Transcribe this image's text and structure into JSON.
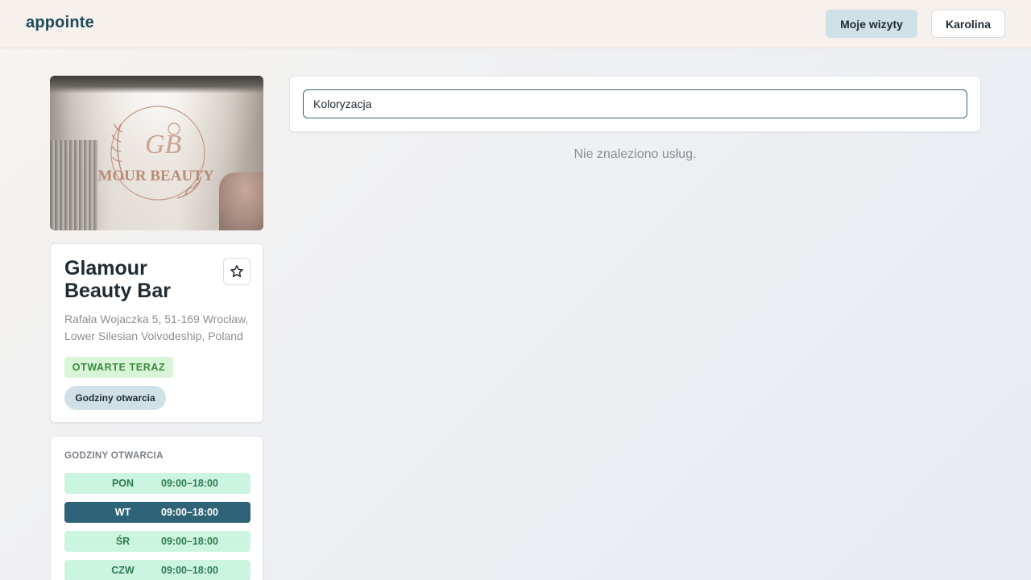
{
  "header": {
    "brand": "appointe",
    "my_visits_label": "Moje wizyty",
    "user_label": "Karolina"
  },
  "salon": {
    "cover_logo_text": "GLAMOUR BEAUTY BAR",
    "name_line1": "Glamour",
    "name_line2": "Beauty Bar",
    "address_line1": "Rafała Wojaczka 5, 51-169 Wrocław,",
    "address_line2": "Lower Silesian Voivodeship, Poland",
    "status_badge": "OTWARTE TERAZ",
    "hours_button": "Godziny otwarcia",
    "favorite_icon": "star-outline-icon"
  },
  "hours": {
    "title": "GODZINY OTWARCIA",
    "days": [
      {
        "day": "PON",
        "hours": "09:00–18:00",
        "today": false
      },
      {
        "day": "WT",
        "hours": "09:00–18:00",
        "today": true
      },
      {
        "day": "ŚR",
        "hours": "09:00–18:00",
        "today": false
      },
      {
        "day": "CZW",
        "hours": "09:00–18:00",
        "today": false
      }
    ]
  },
  "search": {
    "value": "Koloryzacja",
    "placeholder": ""
  },
  "results": {
    "empty_message": "Nie znaleziono usług."
  },
  "colors": {
    "accent": "#2f6478",
    "brand": "#1e4a5c",
    "open_badge_bg": "#d8f5d8",
    "day_bg": "#ccf5e1"
  }
}
